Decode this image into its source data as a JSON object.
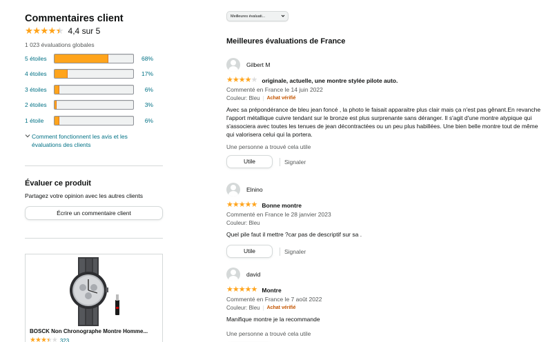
{
  "summary": {
    "title": "Commentaires client",
    "average_rating": 4.4,
    "average_text": "4,4 sur 5",
    "global_count": "1 023 évaluations globales",
    "histogram": [
      {
        "label": "5 étoiles",
        "percent": 68,
        "percent_text": "68%"
      },
      {
        "label": "4 étoiles",
        "percent": 17,
        "percent_text": "17%"
      },
      {
        "label": "3 étoiles",
        "percent": 6,
        "percent_text": "6%"
      },
      {
        "label": "2 étoiles",
        "percent": 3,
        "percent_text": "3%"
      },
      {
        "label": "1 étoile",
        "percent": 6,
        "percent_text": "6%"
      }
    ],
    "how_link": "Comment fonctionnent les avis et les évaluations des clients"
  },
  "rate": {
    "title": "Évaluer ce produit",
    "subtitle": "Partagez votre opinion avec les autres clients",
    "button": "Écrire un commentaire client"
  },
  "product": {
    "title": "BOSCK Non Chronographe Montre Homme...",
    "rating": 3.5,
    "count": "323"
  },
  "sort": {
    "selected": "Meilleures évaluati..."
  },
  "reviews_section": {
    "title": "Meilleures évaluations de France"
  },
  "reviews": [
    {
      "name": "Gilbert M",
      "stars": 4,
      "title": "originale, actuelle, une montre stylée pilote auto.",
      "date": "Commenté en France le 14 juin 2022",
      "color": "Couleur: Bleu",
      "verified": "Achat vérifié",
      "body": "Avec sa prépondérance de bleu jean foncé , la photo le faisait apparaitre plus clair mais ça n'est pas gênant.En revanche l'apport métallique cuivre tendant sur le bronze est plus surprenante sans déranger. Il s'agit d'une montre atypique qui s'associera avec toutes les tenues de jean décontractées ou un peu plus habillées. Une bien belle montre tout de même qui valorisera celui qui la portera.",
      "helpful": "Une personne a trouvé cela utile",
      "useful_button": "Utile",
      "report": "Signaler"
    },
    {
      "name": "Elnino",
      "stars": 5,
      "title": "Bonne montre",
      "date": "Commenté en France le 28 janvier 2023",
      "color": "Couleur: Bleu",
      "body": "Quel pile faut il mettre ?car pas de descriptif sur sa .",
      "useful_button": "Utile",
      "report": "Signaler"
    },
    {
      "name": "david",
      "stars": 5,
      "title": "Montre",
      "date": "Commenté en France le 7 août 2022",
      "color": "Couleur: Bleu",
      "verified": "Achat vérifié",
      "body": "Manifique montre je la recommande",
      "helpful": "Une personne a trouvé cela utile"
    }
  ],
  "colors": {
    "star": "#ffa41c",
    "link": "#007185",
    "verified": "#c45500"
  }
}
